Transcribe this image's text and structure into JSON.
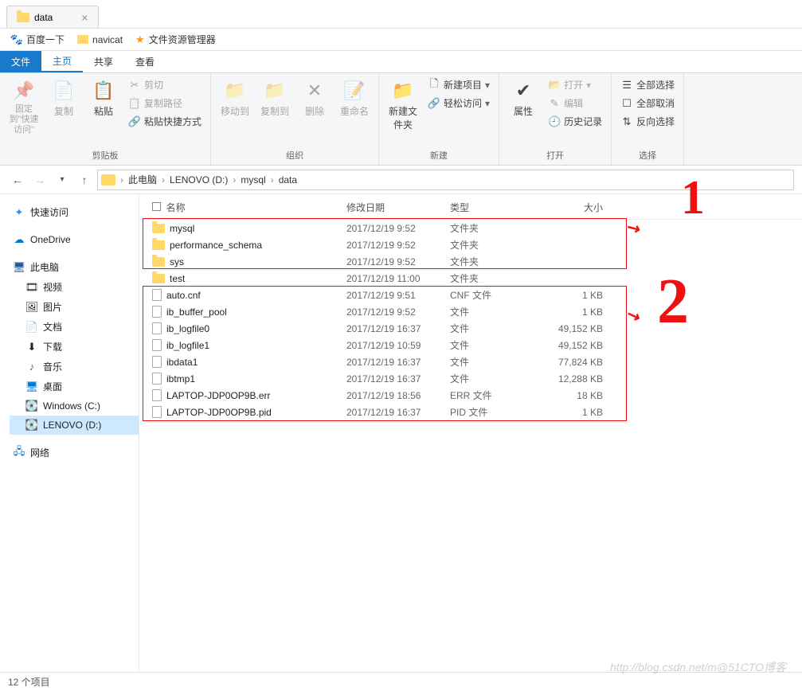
{
  "title_tab": "data",
  "bookmarks": {
    "baidu": "百度一下",
    "navicat": "navicat",
    "explorer": "文件资源管理器"
  },
  "ribbon_tabs": {
    "file": "文件",
    "home": "主页",
    "share": "共享",
    "view": "查看"
  },
  "ribbon": {
    "pin": "固定到\"快速访问\"",
    "copy": "复制",
    "paste": "粘贴",
    "cut": "剪切",
    "copy_path": "复制路径",
    "paste_shortcut": "粘贴快捷方式",
    "clipboard_group": "剪贴板",
    "move_to": "移动到",
    "copy_to": "复制到",
    "delete": "删除",
    "rename": "重命名",
    "organize_group": "组织",
    "new_folder": "新建文件夹",
    "new_item": "新建项目",
    "easy_access": "轻松访问",
    "new_group": "新建",
    "properties": "属性",
    "open": "打开",
    "edit": "编辑",
    "history": "历史记录",
    "open_group": "打开",
    "select_all": "全部选择",
    "select_none": "全部取消",
    "invert_sel": "反向选择",
    "select_group": "选择"
  },
  "breadcrumb": [
    "此电脑",
    "LENOVO (D:)",
    "mysql",
    "data"
  ],
  "sidebar": {
    "quick_access": "快速访问",
    "onedrive": "OneDrive",
    "this_pc": "此电脑",
    "video": "视频",
    "pictures": "图片",
    "documents": "文档",
    "downloads": "下载",
    "music": "音乐",
    "desktop": "桌面",
    "drive_c": "Windows (C:)",
    "drive_d": "LENOVO (D:)",
    "network": "网络"
  },
  "columns": {
    "name": "名称",
    "date": "修改日期",
    "type": "类型",
    "size": "大小"
  },
  "files": [
    {
      "icon": "folder",
      "name": "mysql",
      "date": "2017/12/19 9:52",
      "type": "文件夹",
      "size": ""
    },
    {
      "icon": "folder",
      "name": "performance_schema",
      "date": "2017/12/19 9:52",
      "type": "文件夹",
      "size": ""
    },
    {
      "icon": "folder",
      "name": "sys",
      "date": "2017/12/19 9:52",
      "type": "文件夹",
      "size": ""
    },
    {
      "icon": "folder",
      "name": "test",
      "date": "2017/12/19 11:00",
      "type": "文件夹",
      "size": ""
    },
    {
      "icon": "file",
      "name": "auto.cnf",
      "date": "2017/12/19 9:51",
      "type": "CNF 文件",
      "size": "1 KB"
    },
    {
      "icon": "file",
      "name": "ib_buffer_pool",
      "date": "2017/12/19 9:52",
      "type": "文件",
      "size": "1 KB"
    },
    {
      "icon": "file",
      "name": "ib_logfile0",
      "date": "2017/12/19 16:37",
      "type": "文件",
      "size": "49,152 KB"
    },
    {
      "icon": "file",
      "name": "ib_logfile1",
      "date": "2017/12/19 10:59",
      "type": "文件",
      "size": "49,152 KB"
    },
    {
      "icon": "file",
      "name": "ibdata1",
      "date": "2017/12/19 16:37",
      "type": "文件",
      "size": "77,824 KB"
    },
    {
      "icon": "file",
      "name": "ibtmp1",
      "date": "2017/12/19 16:37",
      "type": "文件",
      "size": "12,288 KB"
    },
    {
      "icon": "file",
      "name": "LAPTOP-JDP0OP9B.err",
      "date": "2017/12/19 18:56",
      "type": "ERR 文件",
      "size": "18 KB"
    },
    {
      "icon": "file",
      "name": "LAPTOP-JDP0OP9B.pid",
      "date": "2017/12/19 16:37",
      "type": "PID 文件",
      "size": "1 KB"
    }
  ],
  "statusbar": "12 个项目",
  "watermark": "http://blog.csdn.net/m@51CTO博客",
  "annotations": {
    "num1": "1",
    "num2": "2"
  }
}
